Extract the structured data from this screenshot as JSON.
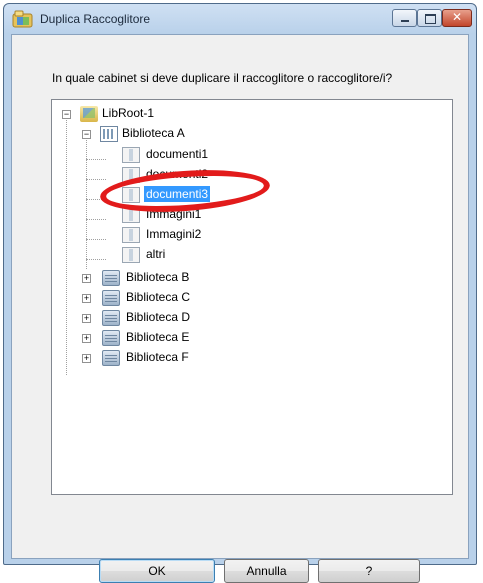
{
  "window": {
    "title": "Duplica Raccoglitore",
    "icon": "app-icon",
    "controls": [
      "minimize",
      "maximize",
      "close"
    ]
  },
  "prompt": "In quale cabinet si deve duplicare il raccoglitore o raccoglitore/i?",
  "tree": {
    "root": {
      "label": "LibRoot-1",
      "icon": "root-icon",
      "expanded": true
    },
    "library_a": {
      "label": "Biblioteca A",
      "icon": "library-icon",
      "expanded": true,
      "children": [
        "documenti1",
        "documenti2",
        "documenti3",
        "Immagini1",
        "Immagini2",
        "altri"
      ],
      "selected": "documenti3"
    },
    "libraries": [
      "Biblioteca B",
      "Biblioteca C",
      "Biblioteca D",
      "Biblioteca E",
      "Biblioteca F"
    ]
  },
  "buttons": {
    "ok": "OK",
    "cancel": "Annulla",
    "help": "?"
  },
  "colors": {
    "selection": "#3399ff",
    "highlight_annotation": "#e21b1b"
  }
}
